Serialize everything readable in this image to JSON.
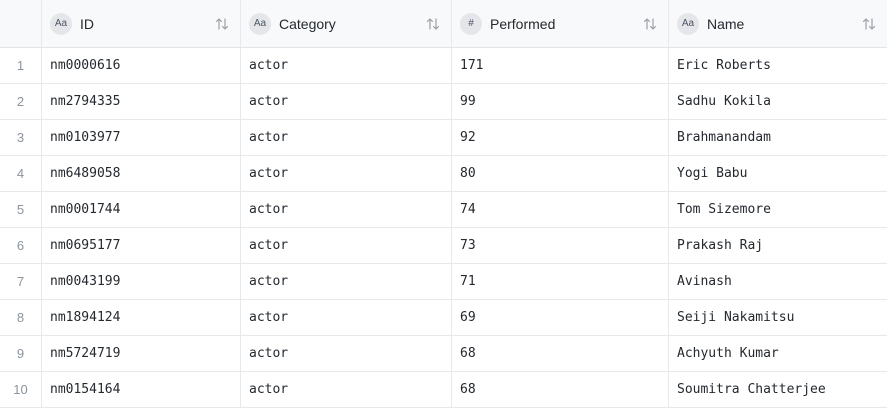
{
  "columns": [
    {
      "type_icon": "Aa",
      "title": "ID"
    },
    {
      "type_icon": "Aa",
      "title": "Category"
    },
    {
      "type_icon": "#",
      "title": "Performed"
    },
    {
      "type_icon": "Aa",
      "title": "Name"
    }
  ],
  "rows": [
    {
      "index": "1",
      "id": "nm0000616",
      "category": "actor",
      "performed": "171",
      "name": "Eric Roberts"
    },
    {
      "index": "2",
      "id": "nm2794335",
      "category": "actor",
      "performed": "99",
      "name": "Sadhu Kokila"
    },
    {
      "index": "3",
      "id": "nm0103977",
      "category": "actor",
      "performed": "92",
      "name": "Brahmanandam"
    },
    {
      "index": "4",
      "id": "nm6489058",
      "category": "actor",
      "performed": "80",
      "name": "Yogi Babu"
    },
    {
      "index": "5",
      "id": "nm0001744",
      "category": "actor",
      "performed": "74",
      "name": "Tom Sizemore"
    },
    {
      "index": "6",
      "id": "nm0695177",
      "category": "actor",
      "performed": "73",
      "name": "Prakash Raj"
    },
    {
      "index": "7",
      "id": "nm0043199",
      "category": "actor",
      "performed": "71",
      "name": "Avinash"
    },
    {
      "index": "8",
      "id": "nm1894124",
      "category": "actor",
      "performed": "69",
      "name": "Seiji Nakamitsu"
    },
    {
      "index": "9",
      "id": "nm5724719",
      "category": "actor",
      "performed": "68",
      "name": "Achyuth Kumar"
    },
    {
      "index": "10",
      "id": "nm0154164",
      "category": "actor",
      "performed": "68",
      "name": "Soumitra Chatterjee"
    }
  ]
}
